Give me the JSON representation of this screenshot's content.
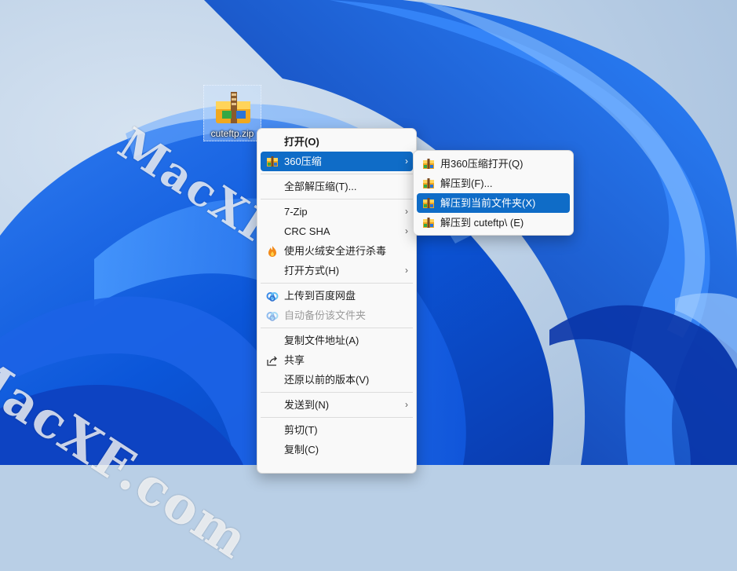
{
  "desktop": {
    "file_icon_label": "cuteftp.zip",
    "watermark": "MacXF.com"
  },
  "context_menu": {
    "items": [
      {
        "label": "打开(O)"
      },
      {
        "label": "360压缩"
      },
      {
        "label": "全部解压缩(T)..."
      },
      {
        "label": "7-Zip"
      },
      {
        "label": "CRC SHA"
      },
      {
        "label": "使用火绒安全进行杀毒"
      },
      {
        "label": "打开方式(H)"
      },
      {
        "label": "上传到百度网盘"
      },
      {
        "label": "自动备份该文件夹"
      },
      {
        "label": "复制文件地址(A)"
      },
      {
        "label": "共享"
      },
      {
        "label": "还原以前的版本(V)"
      },
      {
        "label": "发送到(N)"
      },
      {
        "label": "剪切(T)"
      },
      {
        "label": "复制(C)"
      }
    ]
  },
  "submenu_360": {
    "items": [
      {
        "label": "用360压缩打开(Q)"
      },
      {
        "label": "解压到(F)..."
      },
      {
        "label": "解压到当前文件夹(X)"
      },
      {
        "label": "解压到 cuteftp\\ (E)"
      }
    ]
  },
  "colors": {
    "highlight": "#0f6cc7",
    "menu_bg": "#f9f9f9",
    "disabled_text": "#9c9c9c"
  }
}
